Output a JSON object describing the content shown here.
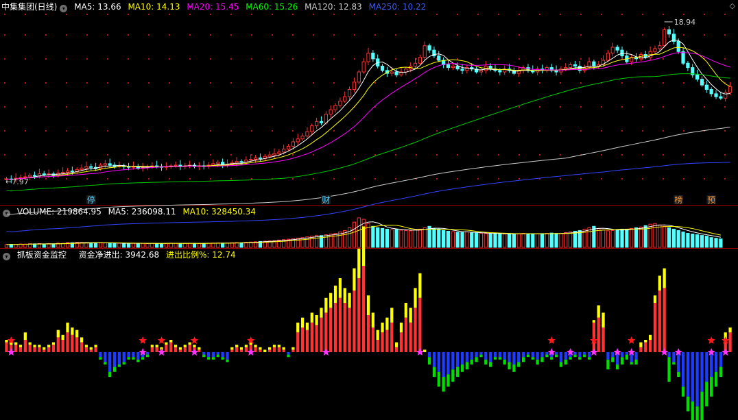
{
  "header_price": {
    "name": "中集集团(日线)",
    "items": [
      {
        "label": "MA5: 13.66",
        "color": "#ffffff"
      },
      {
        "label": "MA10: 14.13",
        "color": "#ffff00"
      },
      {
        "label": "MA20: 15.45",
        "color": "#ff00ff"
      },
      {
        "label": "MA60: 15.26",
        "color": "#00ff00"
      },
      {
        "label": "MA120: 12.83",
        "color": "#cccccc"
      },
      {
        "label": "MA250: 10.22",
        "color": "#3a5bff"
      }
    ]
  },
  "header_volume": {
    "items": [
      {
        "label": "VOLUME: 219864.95",
        "color": "#ffffff"
      },
      {
        "label": "MA5: 236098.11",
        "color": "#ffffff"
      },
      {
        "label": "MA10: 328450.34",
        "color": "#ffff00"
      }
    ]
  },
  "header_indicator": {
    "name": "抓板资金监控",
    "items": [
      {
        "label": "资金净进出: 3942.68",
        "color": "#ffffff"
      },
      {
        "label": "进出比例%: 12.74",
        "color": "#ffff00"
      }
    ]
  },
  "colors": {
    "up": "#ff3333",
    "down": "#54ffff",
    "blue": "#1e3cff",
    "yellow": "#ffff00",
    "green": "#00dd00",
    "grid": "#a00000",
    "magenta": "#ff00ff",
    "star": "#ff1a1a",
    "ma60": "#00cc00",
    "ma120": "#cccccc",
    "ma250": "#3344ff"
  },
  "chart_data": [
    {
      "type": "candlestick",
      "title": "中集集团(日线)",
      "ylim": [
        7.5,
        19.5
      ],
      "annotations": [
        {
          "text": "18.94",
          "kind": "high"
        },
        {
          "text": "7.97",
          "kind": "low"
        }
      ],
      "event_badges": [
        "停",
        "财",
        "榜",
        "预"
      ],
      "close": [
        8.15,
        8.1,
        8.2,
        8.25,
        8.3,
        8.4,
        8.35,
        8.5,
        8.45,
        8.5,
        8.4,
        8.55,
        8.6,
        8.7,
        8.65,
        8.8,
        8.9,
        9.0,
        8.95,
        8.85,
        9.1,
        9.2,
        9.1,
        9.0,
        9.05,
        9.0,
        8.95,
        9.0,
        8.9,
        8.95,
        9.0,
        9.05,
        9.0,
        8.95,
        9.0,
        9.05,
        9.1,
        9.0,
        9.05,
        9.1,
        9.0,
        9.05,
        9.0,
        9.1,
        9.2,
        9.3,
        9.1,
        9.15,
        9.25,
        9.35,
        9.3,
        9.45,
        9.5,
        9.6,
        9.55,
        9.7,
        9.8,
        9.9,
        10.0,
        10.2,
        10.4,
        10.7,
        10.9,
        11.1,
        11.4,
        11.8,
        12.1,
        12.0,
        12.6,
        12.9,
        13.2,
        13.5,
        13.8,
        14.3,
        14.8,
        15.5,
        16.2,
        16.8,
        16.4,
        15.9,
        15.6,
        15.4,
        15.5,
        15.3,
        15.5,
        15.7,
        15.9,
        16.1,
        16.5,
        17.3,
        17.0,
        16.6,
        16.3,
        16.0,
        15.8,
        15.9,
        15.7,
        15.6,
        15.8,
        15.7,
        15.5,
        15.6,
        15.9,
        15.7,
        15.6,
        15.5,
        15.7,
        15.6,
        15.4,
        15.6,
        15.8,
        15.6,
        15.5,
        15.7,
        15.6,
        15.8,
        15.6,
        15.5,
        15.7,
        15.8,
        16.0,
        15.9,
        15.6,
        15.8,
        16.2,
        15.9,
        16.0,
        16.3,
        16.8,
        17.2,
        17.0,
        16.6,
        16.2,
        16.5,
        16.4,
        16.7,
        16.5,
        16.9,
        17.1,
        17.3,
        18.4,
        18.1,
        17.6,
        16.9,
        16.1,
        15.8,
        15.3,
        15.0,
        14.6,
        14.3,
        14.0,
        13.8,
        13.7,
        14.1,
        14.5
      ]
    },
    {
      "type": "bar",
      "title": "VOLUME",
      "series_ma": [
        "MA5",
        "MA10"
      ],
      "values": [
        20,
        22,
        21,
        24,
        23,
        26,
        25,
        27,
        24,
        26,
        25,
        30,
        29,
        34,
        33,
        36,
        35,
        32,
        31,
        33,
        34,
        31,
        30,
        28,
        29,
        28,
        27,
        30,
        29,
        28,
        27,
        29,
        28,
        27,
        29,
        30,
        29,
        27,
        28,
        29,
        28,
        27,
        29,
        30,
        31,
        32,
        30,
        31,
        33,
        34,
        33,
        36,
        38,
        40,
        42,
        44,
        46,
        48,
        52,
        55,
        58,
        62,
        66,
        70,
        75,
        80,
        86,
        84,
        90,
        95,
        100,
        110,
        120,
        140,
        180,
        210,
        200,
        170,
        150,
        140,
        135,
        130,
        125,
        128,
        122,
        120,
        118,
        125,
        130,
        140,
        150,
        135,
        130,
        120,
        115,
        112,
        108,
        106,
        110,
        104,
        102,
        100,
        98,
        96,
        100,
        98,
        95,
        94,
        96,
        98,
        100,
        97,
        95,
        96,
        98,
        100,
        102,
        98,
        99,
        105,
        110,
        115,
        120,
        130,
        140,
        150,
        135,
        125,
        118,
        120,
        125,
        130,
        128,
        135,
        140,
        145,
        155,
        165,
        170,
        160,
        150,
        140,
        130,
        120,
        110,
        100,
        95,
        90,
        85,
        80,
        70,
        65,
        60
      ]
    },
    {
      "type": "bar",
      "title": "抓板资金监控",
      "series": [
        {
          "name": "资金净进出",
          "values": [
            4,
            3,
            3,
            2,
            5,
            3,
            2,
            2,
            1,
            2,
            3,
            6,
            5,
            8,
            7,
            6,
            4,
            2,
            1,
            2,
            -2,
            -4,
            -8,
            -6,
            -5,
            -4,
            -2,
            -2,
            -3,
            -2,
            -1,
            2,
            2,
            1,
            3,
            4,
            2,
            1,
            2,
            3,
            2,
            1,
            -1,
            -2,
            -2,
            -1,
            -2,
            -3,
            1,
            2,
            1,
            2,
            3,
            2,
            1,
            0,
            1,
            2,
            2,
            1,
            -1,
            1,
            8,
            10,
            9,
            12,
            11,
            14,
            16,
            18,
            20,
            22,
            20,
            18,
            25,
            30,
            35,
            15,
            10,
            5,
            8,
            9,
            12,
            2,
            8,
            14,
            12,
            18,
            22,
            0,
            -2,
            -6,
            -8,
            -10,
            -9,
            -7,
            -6,
            -5,
            -4,
            -3,
            -2,
            -1,
            -3,
            -4,
            -2,
            -2,
            -3,
            -4,
            -5,
            -4,
            -2,
            -1,
            -2,
            -3,
            -2,
            -1,
            -2,
            -1,
            -4,
            -3,
            -2,
            -1,
            -2,
            -1,
            -2,
            12,
            14,
            10,
            -3,
            -2,
            -5,
            -2,
            -1,
            -4,
            -3,
            2,
            4,
            5,
            20,
            25,
            26,
            -2,
            -4,
            -8,
            -14,
            -18,
            -20,
            -22,
            -16,
            -12,
            -10,
            -8,
            -6,
            5,
            8
          ]
        },
        {
          "name": "进出比例%",
          "values": [
            1,
            1,
            1,
            1,
            3,
            1,
            1,
            1,
            1,
            1,
            1,
            3,
            2,
            4,
            3,
            3,
            2,
            1,
            1,
            1,
            1,
            1,
            2,
            2,
            1,
            1,
            1,
            1,
            1,
            1,
            1,
            1,
            1,
            1,
            1,
            1,
            1,
            1,
            1,
            1,
            1,
            1,
            1,
            1,
            1,
            1,
            1,
            1,
            1,
            1,
            1,
            1,
            1,
            1,
            1,
            1,
            1,
            1,
            1,
            1,
            1,
            1,
            4,
            4,
            3,
            4,
            4,
            4,
            6,
            6,
            7,
            8,
            6,
            6,
            9,
            12,
            16,
            8,
            6,
            4,
            4,
            5,
            6,
            2,
            4,
            6,
            6,
            8,
            10,
            1,
            3,
            4,
            6,
            6,
            5,
            5,
            4,
            3,
            3,
            2,
            2,
            1,
            2,
            2,
            1,
            1,
            2,
            3,
            3,
            2,
            2,
            1,
            1,
            2,
            2,
            1,
            1,
            1,
            2,
            2,
            1,
            1,
            1,
            1,
            1,
            1,
            5,
            6,
            4,
            2,
            2,
            3,
            2,
            1,
            2,
            2,
            1,
            2,
            3,
            6,
            8,
            10,
            1,
            2,
            4,
            6,
            8,
            10,
            12,
            10,
            8,
            6,
            4,
            3,
            2,
            3
          ]
        }
      ]
    }
  ]
}
